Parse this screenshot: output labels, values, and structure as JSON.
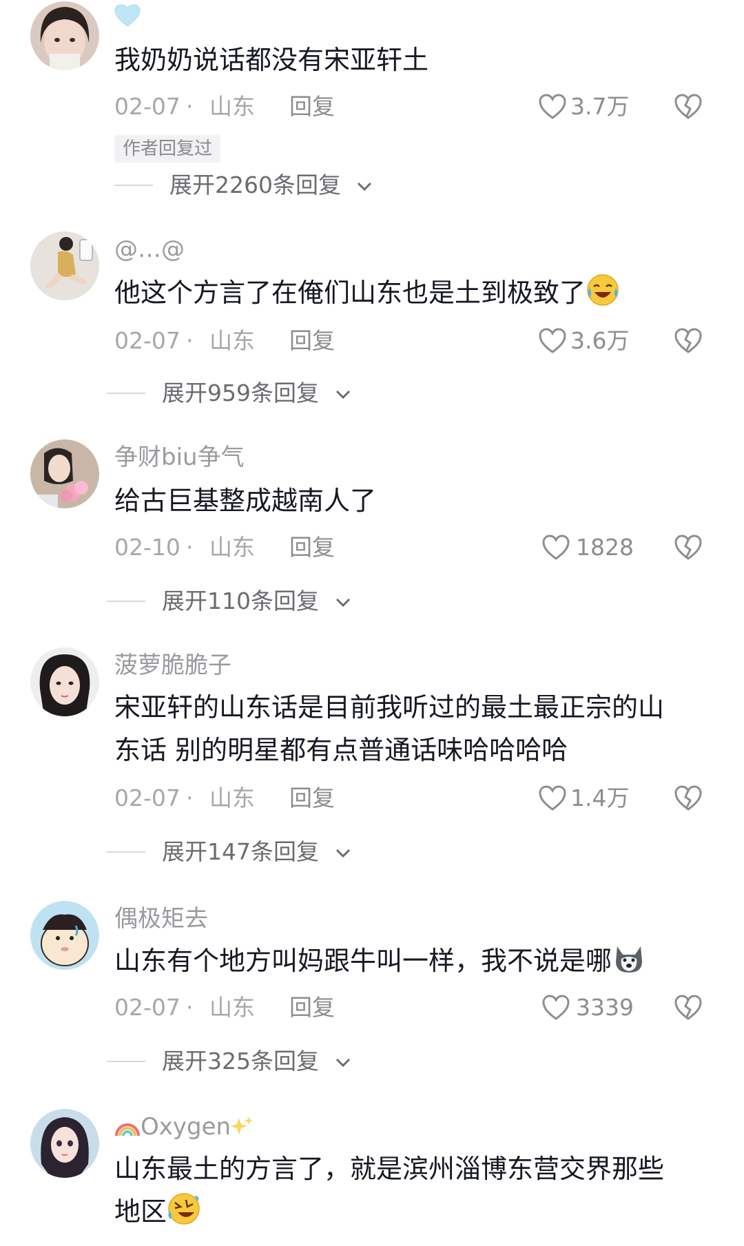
{
  "colors": {
    "text_primary": "#161823",
    "text_secondary": "#a6a6ab",
    "badge_bg": "#f2f2f4"
  },
  "comments": [
    {
      "username": "",
      "username_icon": "light-blue-heart-icon",
      "text": "我奶奶说话都没有宋亚轩土",
      "date": "02-07",
      "region": "山东",
      "reply_label": "回复",
      "likes": "3.7万",
      "author_badge": "作者回复过",
      "expand_label": "展开2260条回复"
    },
    {
      "username": "@…@",
      "text": "他这个方言了在俺们山东也是土到极致了",
      "text_emoji": "laughing-crying-emoji",
      "date": "02-07",
      "region": "山东",
      "reply_label": "回复",
      "likes": "3.6万",
      "expand_label": "展开959条回复"
    },
    {
      "username": "争财biu争气",
      "text": "给古巨基整成越南人了",
      "date": "02-10",
      "region": "山东",
      "reply_label": "回复",
      "likes": "1828",
      "expand_label": "展开110条回复"
    },
    {
      "username": "菠萝脆脆子",
      "text_line1": "宋亚轩的山东话是目前我听过的最土最正宗的山",
      "text_line2": "东话 别的明星都有点普通话味哈哈哈哈",
      "date": "02-07",
      "region": "山东",
      "reply_label": "回复",
      "likes": "1.4万",
      "expand_label": "展开147条回复"
    },
    {
      "username": "偶极矩去",
      "text": "山东有个地方叫妈跟牛叫一样，我不说是哪",
      "text_emoji": "husky-dog-emoji",
      "date": "02-07",
      "region": "山东",
      "reply_label": "回复",
      "likes": "3339",
      "expand_label": "展开325条回复"
    },
    {
      "username": "Oxygen",
      "username_prefix_icon": "rainbow-icon",
      "username_suffix_icon": "sparkles-icon",
      "text_line1": "山东最土的方言了，就是滨州淄博东营交界那些",
      "text_line2": "地区",
      "text_emoji": "rolling-laughing-emoji"
    }
  ],
  "icons": {
    "like": "heart-outline-icon",
    "dislike": "broken-heart-icon",
    "expand": "chevron-down-icon"
  }
}
